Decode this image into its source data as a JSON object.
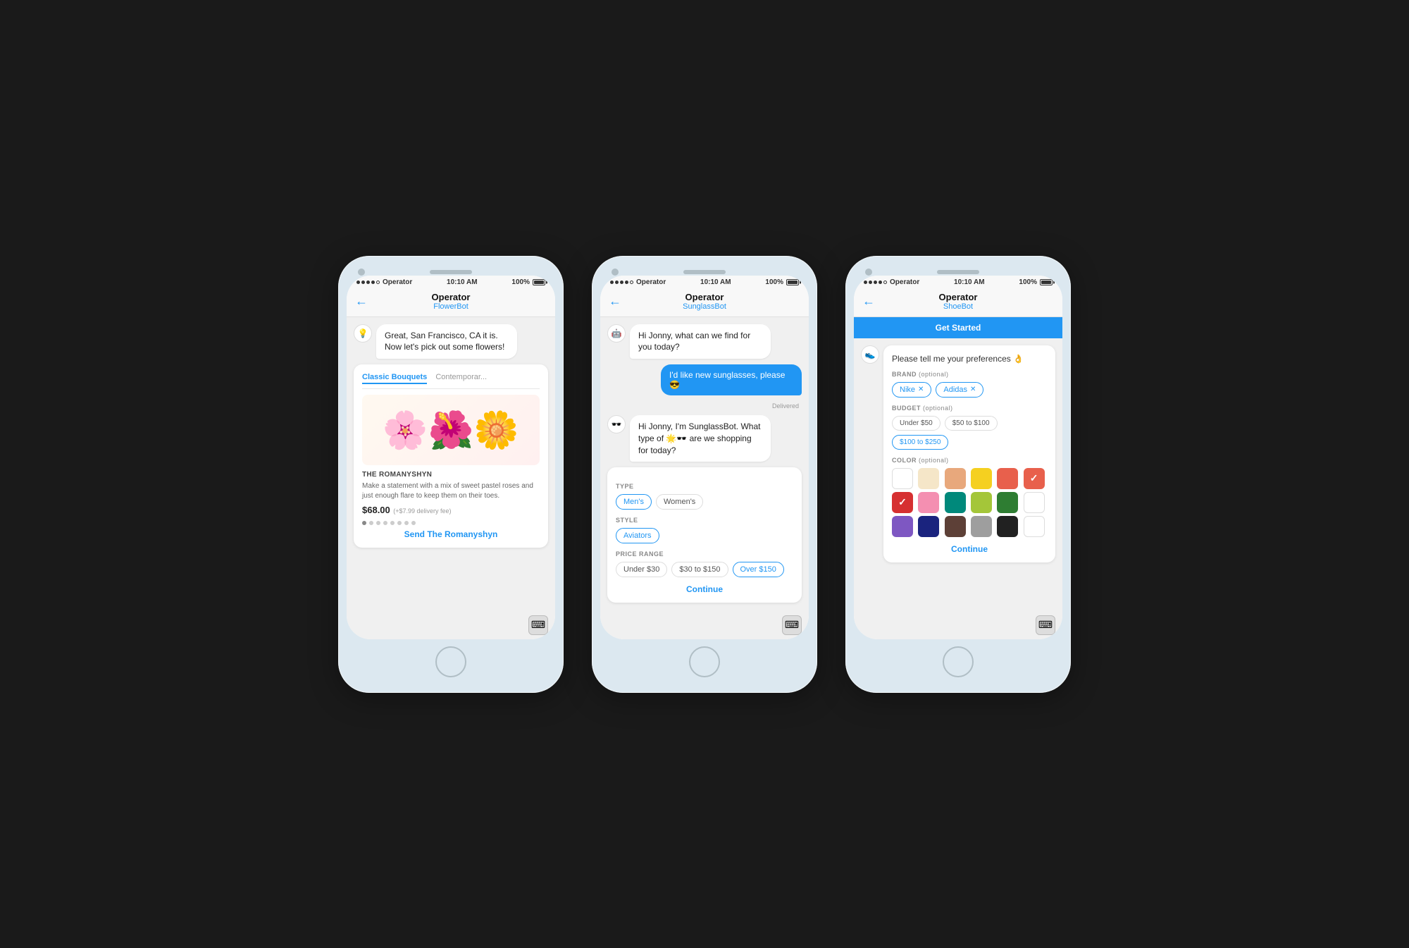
{
  "phones": [
    {
      "id": "flower-bot",
      "status": {
        "carrier": "Operator",
        "time": "10:10 AM",
        "battery": "100%"
      },
      "nav": {
        "title": "Operator",
        "subtitle": "FlowerBot",
        "back": "←"
      },
      "messages": [
        {
          "type": "bot",
          "avatar": "💡",
          "text": "Great, San Francisco, CA it is. Now let's pick out some flowers!"
        }
      ],
      "card": {
        "tabs": [
          "Classic Bouquets",
          "Contemporar..."
        ],
        "active_tab": 0,
        "flower_emoji": "💐",
        "product_name": "THE ROMANYSHYN",
        "product_desc": "Make a statement with a mix of sweet pastel roses and just enough flare to keep them on their toes.",
        "price": "$68.00",
        "price_sub": "(+$7.99 delivery fee)",
        "send_label": "Send The Romanyshyn"
      }
    },
    {
      "id": "sunglass-bot",
      "status": {
        "carrier": "Operator",
        "time": "10:10 AM",
        "battery": "100%"
      },
      "nav": {
        "title": "Operator",
        "subtitle": "SunglassBot",
        "back": "←"
      },
      "messages": [
        {
          "type": "bot",
          "avatar": "🤖",
          "text": "Hi Jonny, what can we find for you today?"
        },
        {
          "type": "user",
          "text": "I'd like new sunglasses, please 😎"
        },
        {
          "type": "delivered"
        },
        {
          "type": "bot",
          "avatar": "🕶️",
          "text": "Hi Jonny, I'm SunglassBot. What type of 🌟🕶️ are we shopping for today?"
        }
      ],
      "form": {
        "sections": [
          {
            "label": "TYPE",
            "chips": [
              "Men's",
              "Women's"
            ],
            "selected": [
              "Men's"
            ]
          },
          {
            "label": "STYLE",
            "chips": [
              "Aviators"
            ],
            "selected": [
              "Aviators"
            ]
          },
          {
            "label": "PRICE RANGE",
            "chips": [
              "Under $30",
              "$30 to $150",
              "Over $150"
            ],
            "selected": [
              "Over $150"
            ]
          }
        ],
        "continue_label": "Continue"
      }
    },
    {
      "id": "shoe-bot",
      "status": {
        "carrier": "Operator",
        "time": "10:10 AM",
        "battery": "100%"
      },
      "nav": {
        "title": "Operator",
        "subtitle": "ShoeBot",
        "back": "←"
      },
      "top_btn": "Get Started",
      "bot_avatar": "👟",
      "form": {
        "intro": "Please tell me your preferences 👌",
        "sections": [
          {
            "label": "BRAND",
            "sublabel": "(optional)",
            "type": "tags",
            "tags": [
              "Nike",
              "Adidas"
            ]
          },
          {
            "label": "BUDGET",
            "sublabel": "(optional)",
            "type": "chips",
            "chips": [
              "Under $50",
              "$50 to $100",
              "$100 to $250"
            ],
            "selected": [
              "$100 to $250"
            ]
          },
          {
            "label": "COLOR",
            "sublabel": "(optional)",
            "type": "colors"
          }
        ],
        "colors": [
          {
            "hex": "#ffffff",
            "selected": false,
            "white": true
          },
          {
            "hex": "#f5e6c8",
            "selected": false
          },
          {
            "hex": "#e8a87c",
            "selected": false
          },
          {
            "hex": "#f5d020",
            "selected": false
          },
          {
            "hex": "#e8604c",
            "selected": false
          },
          {
            "hex": "#e8604c",
            "selected": true
          },
          {
            "hex": "#d63031",
            "selected": true
          },
          {
            "hex": "#f48fb1",
            "selected": false
          },
          {
            "hex": "#00897b",
            "selected": false
          },
          {
            "hex": "#a4c639",
            "selected": false
          },
          {
            "hex": "#2e7d32",
            "selected": false
          },
          {
            "hex": "#ffffff",
            "selected": false,
            "white": true
          },
          {
            "hex": "#7e57c2",
            "selected": false
          },
          {
            "hex": "#1a237e",
            "selected": false
          },
          {
            "hex": "#5d4037",
            "selected": false
          },
          {
            "hex": "#9e9e9e",
            "selected": false
          },
          {
            "hex": "#212121",
            "selected": false
          },
          {
            "hex": "#ffffff",
            "selected": false,
            "white": true
          }
        ],
        "continue_label": "Continue"
      }
    }
  ]
}
